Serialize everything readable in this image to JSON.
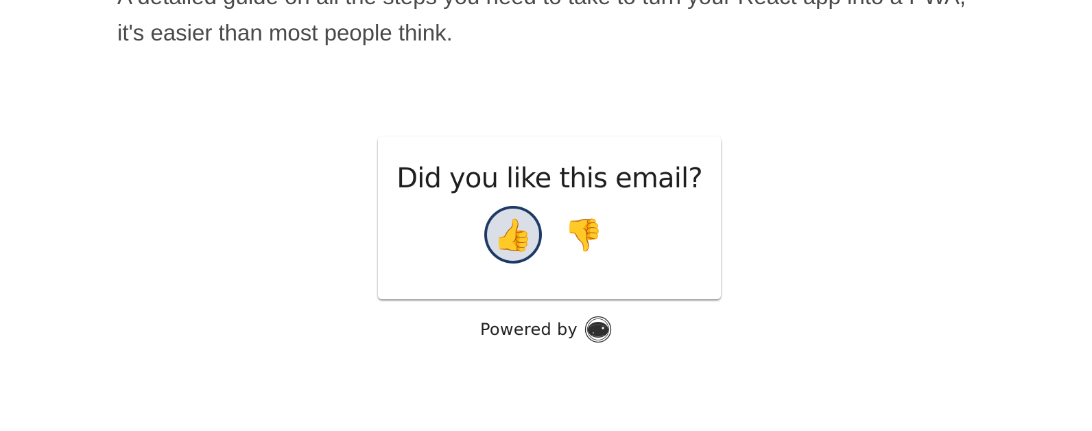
{
  "intro": {
    "line1": "A detailed guide on all the steps you need to take to turn your React app into a PWA,",
    "line2": "it's easier than most people think."
  },
  "feedback": {
    "question": "Did you like this email?",
    "like_emoji": "👍",
    "dislike_emoji": "👎",
    "selected": "like"
  },
  "footer": {
    "powered_by": "Powered by",
    "logo_icon": "brand-logo-icon"
  },
  "colors": {
    "selected_border": "#1d3a66",
    "selected_background": "#dadee6",
    "emoji": "#f4b73b"
  }
}
